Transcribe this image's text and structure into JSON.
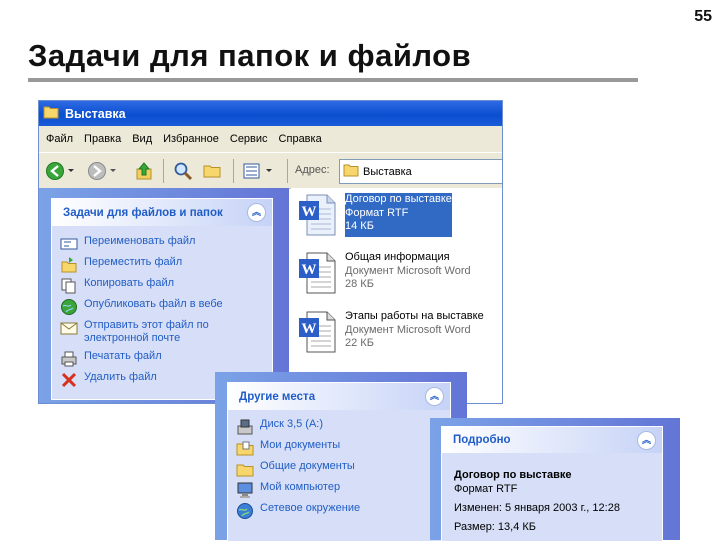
{
  "slide": {
    "page_number": "55",
    "title": "Задачи для папок и файлов"
  },
  "window": {
    "title": "Выставка",
    "menu": [
      "Файл",
      "Правка",
      "Вид",
      "Избранное",
      "Сервис",
      "Справка"
    ],
    "address_label": "Адрес:",
    "address_value": "Выставка"
  },
  "file_tasks": {
    "title": "Задачи для файлов и папок",
    "items": [
      {
        "label": "Переименовать файл",
        "icon": "rename-icon"
      },
      {
        "label": "Переместить файл",
        "icon": "move-icon"
      },
      {
        "label": "Копировать файл",
        "icon": "copy-icon"
      },
      {
        "label": "Опубликовать файл в вебе",
        "icon": "web-publish-icon"
      },
      {
        "label": "Отправить этот файл по электронной почте",
        "icon": "email-icon"
      },
      {
        "label": "Печатать файл",
        "icon": "printer-icon"
      },
      {
        "label": "Удалить файл",
        "icon": "delete-icon"
      }
    ]
  },
  "files": [
    {
      "name": "Договор по выставке",
      "type": "Формат RTF",
      "size": "14 КБ",
      "selected": true
    },
    {
      "name": "Общая информация",
      "type": "Документ Microsoft Word",
      "size": "28 КБ",
      "selected": false
    },
    {
      "name": "Этапы работы на выставке",
      "type": "Документ Microsoft Word",
      "size": "22 КБ",
      "selected": false
    }
  ],
  "other_places": {
    "title": "Другие места",
    "items": [
      {
        "label": "Диск 3,5 (A:)",
        "icon": "floppy-drive-icon"
      },
      {
        "label": "Мои документы",
        "icon": "my-documents-icon"
      },
      {
        "label": "Общие документы",
        "icon": "shared-documents-icon"
      },
      {
        "label": "Мой компьютер",
        "icon": "my-computer-icon"
      },
      {
        "label": "Сетевое окружение",
        "icon": "network-icon"
      }
    ]
  },
  "details": {
    "title": "Подробно",
    "file_name": "Договор по выставке",
    "file_type": "Формат RTF",
    "modified": "Изменен: 5 января 2003 г., 12:28",
    "size": "Размер: 13,4 КБ"
  },
  "colors": {
    "titlebar": "#0a4fd0",
    "task_link": "#215dc6",
    "panel_bg": "#d6dff7",
    "selection": "#316ac5"
  }
}
